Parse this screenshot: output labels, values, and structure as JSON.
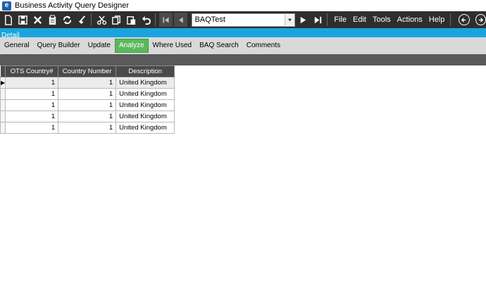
{
  "window": {
    "title": "Business Activity Query Designer",
    "logo_letter": "e"
  },
  "toolbar": {
    "icons": [
      "new-icon",
      "save-icon",
      "delete-icon",
      "clipboard-icon",
      "refresh-icon",
      "clear-icon",
      "cut-icon",
      "copy-icon",
      "paste-icon",
      "undo-icon"
    ],
    "query_name": "BAQTest",
    "menu": [
      "File",
      "Edit",
      "Tools",
      "Actions",
      "Help"
    ]
  },
  "detail_label": "Detail",
  "tabs": [
    {
      "label": "General",
      "active": false
    },
    {
      "label": "Query Builder",
      "active": false
    },
    {
      "label": "Update",
      "active": false
    },
    {
      "label": "Analyze",
      "active": true
    },
    {
      "label": "Where Used",
      "active": false
    },
    {
      "label": "BAQ Search",
      "active": false
    },
    {
      "label": "Comments",
      "active": false
    }
  ],
  "grid": {
    "columns": [
      "OTS Country#",
      "Country Number",
      "Description"
    ],
    "rows": [
      [
        "1",
        "1",
        "United Kingdom"
      ],
      [
        "1",
        "1",
        "United Kingdom"
      ],
      [
        "1",
        "1",
        "United Kingdom"
      ],
      [
        "1",
        "1",
        "United Kingdom"
      ],
      [
        "1",
        "1",
        "United Kingdom"
      ]
    ],
    "current_row_indicator": "▶"
  },
  "colors": {
    "toolbar_bg": "#2e2e2e",
    "detail_bar": "#1ba3e0",
    "active_tab": "#5cb85c",
    "grid_header": "#4a4a4a"
  }
}
